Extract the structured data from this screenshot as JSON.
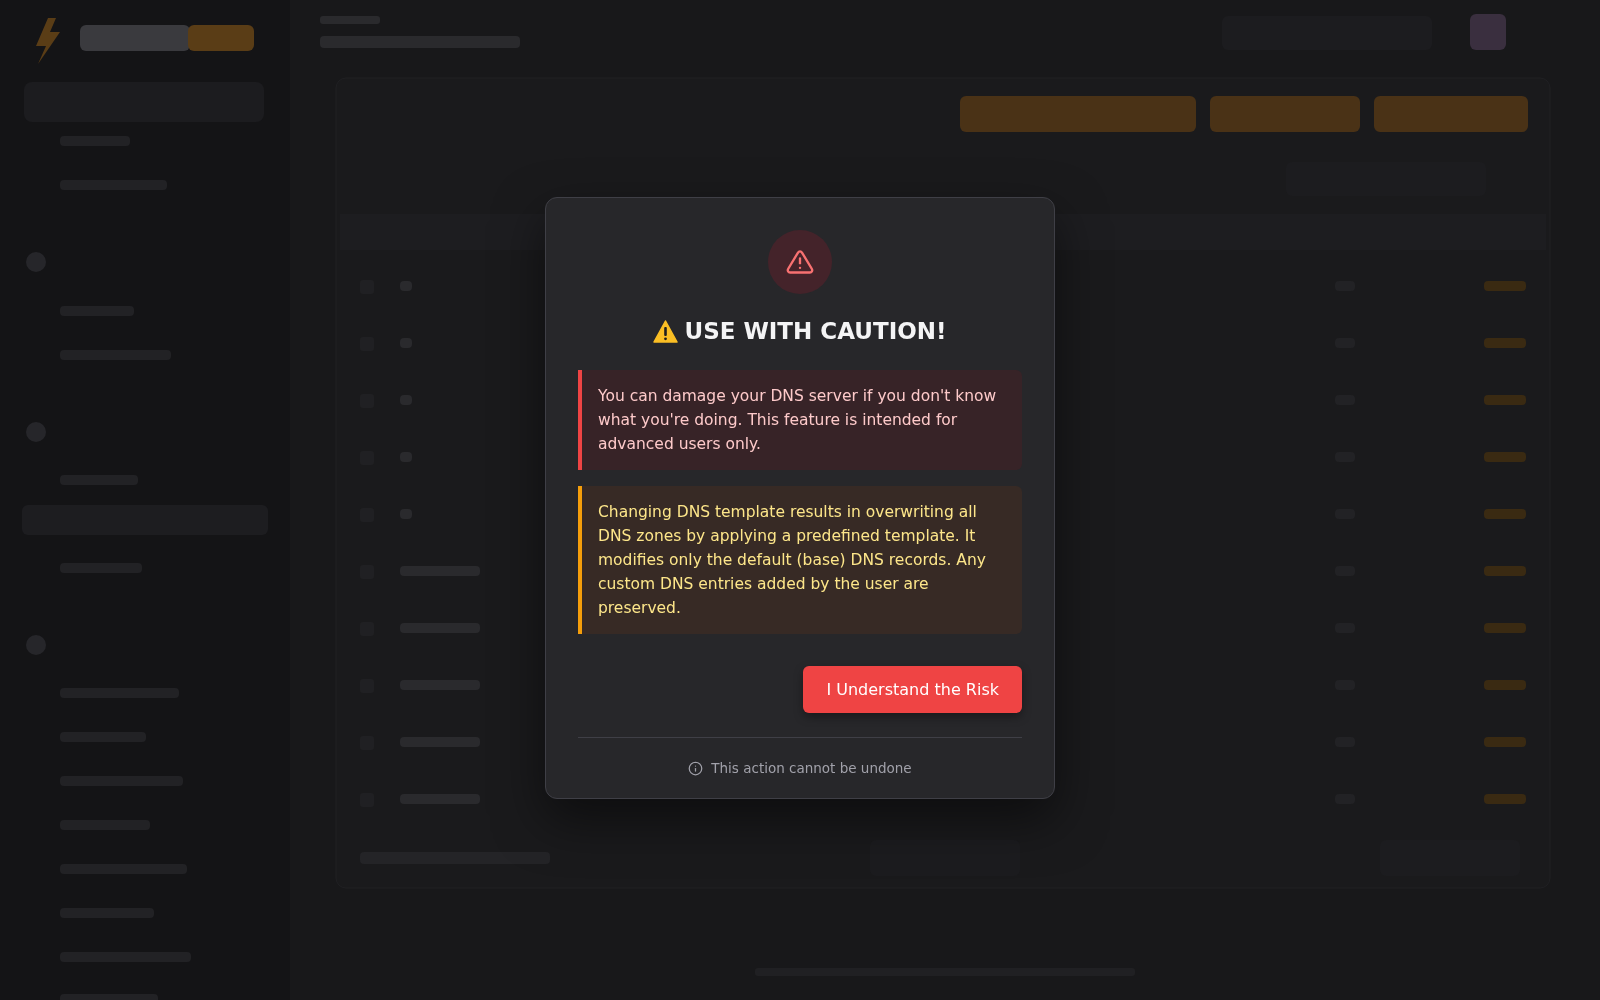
{
  "dialog": {
    "title": "USE WITH CAUTION!",
    "alerts": [
      {
        "kind": "danger",
        "text": "You can damage your DNS server if you don't know what you're doing. This feature is intended for advanced users only."
      },
      {
        "kind": "warning",
        "text": "Changing DNS template results in overwriting all DNS zones by applying a predefined template. It modifies only the default (base) DNS records. Any custom DNS entries added by the user are preserved."
      }
    ],
    "confirm_button": "I Understand the Risk",
    "footer_note": "This action cannot be undone"
  }
}
